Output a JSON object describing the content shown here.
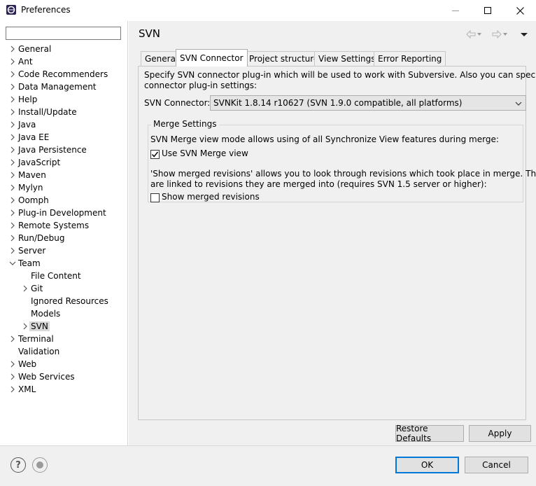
{
  "window": {
    "title": "Preferences",
    "minimize_glyph": "—",
    "maximize_glyph": "☐",
    "close_glyph": "✕"
  },
  "filter": {
    "value": "",
    "placeholder": ""
  },
  "tree": {
    "items": [
      {
        "label": "General",
        "expander": "›"
      },
      {
        "label": "Ant",
        "expander": "›"
      },
      {
        "label": "Code Recommenders",
        "expander": "›"
      },
      {
        "label": "Data Management",
        "expander": "›"
      },
      {
        "label": "Help",
        "expander": "›"
      },
      {
        "label": "Install/Update",
        "expander": "›"
      },
      {
        "label": "Java",
        "expander": "›"
      },
      {
        "label": "Java EE",
        "expander": "›"
      },
      {
        "label": "Java Persistence",
        "expander": "›"
      },
      {
        "label": "JavaScript",
        "expander": "›"
      },
      {
        "label": "Maven",
        "expander": "›"
      },
      {
        "label": "Mylyn",
        "expander": "›"
      },
      {
        "label": "Oomph",
        "expander": "›"
      },
      {
        "label": "Plug-in Development",
        "expander": "›"
      },
      {
        "label": "Remote Systems",
        "expander": "›"
      },
      {
        "label": "Run/Debug",
        "expander": "›"
      },
      {
        "label": "Server",
        "expander": "›"
      },
      {
        "label": "Team",
        "expander": "⌄"
      },
      {
        "label": "File Content",
        "expander": ""
      },
      {
        "label": "Git",
        "expander": "›"
      },
      {
        "label": "Ignored Resources",
        "expander": ""
      },
      {
        "label": "Models",
        "expander": ""
      },
      {
        "label": "SVN",
        "expander": "›"
      },
      {
        "label": "Terminal",
        "expander": "›"
      },
      {
        "label": "Validation",
        "expander": ""
      },
      {
        "label": "Web",
        "expander": "›"
      },
      {
        "label": "Web Services",
        "expander": "›"
      },
      {
        "label": "XML",
        "expander": "›"
      }
    ],
    "selected": "SVN"
  },
  "page": {
    "title": "SVN",
    "tabs": [
      "General",
      "SVN Connector",
      "Project structure",
      "View Settings",
      "Error Reporting"
    ],
    "active_tab": "SVN Connector",
    "description": "Specify SVN connector plug-in which will be used to work with Subversive. Also you can specify",
    "description2": "connector plug-in settings:",
    "connector_label": "SVN Connector:",
    "connector_value": "SVNKit 1.8.14 r10627 (SVN 1.9.0 compatible, all platforms)",
    "merge_group": {
      "title": "Merge Settings",
      "merge_view_text": "SVN Merge view mode allows using of all Synchronize View features during merge:",
      "use_merge_view_label": "Use SVN Merge view",
      "use_merge_view_checked": true,
      "show_merged_text1": "'Show merged revisions' allows you to look through revisions which took place in merge. They",
      "show_merged_text2": "are linked to revisions they are merged into (requires SVN 1.5 server or higher):",
      "show_merged_label": "Show merged revisions",
      "show_merged_checked": false
    },
    "restore_defaults_label": "Restore Defaults",
    "apply_label": "Apply"
  },
  "bottom": {
    "ok_label": "OK",
    "cancel_label": "Cancel",
    "help_glyph": "?"
  },
  "colors": {
    "accent": "#0078d7",
    "selection": "#d9d9d9",
    "panel_bg": "#f0f0f0"
  }
}
